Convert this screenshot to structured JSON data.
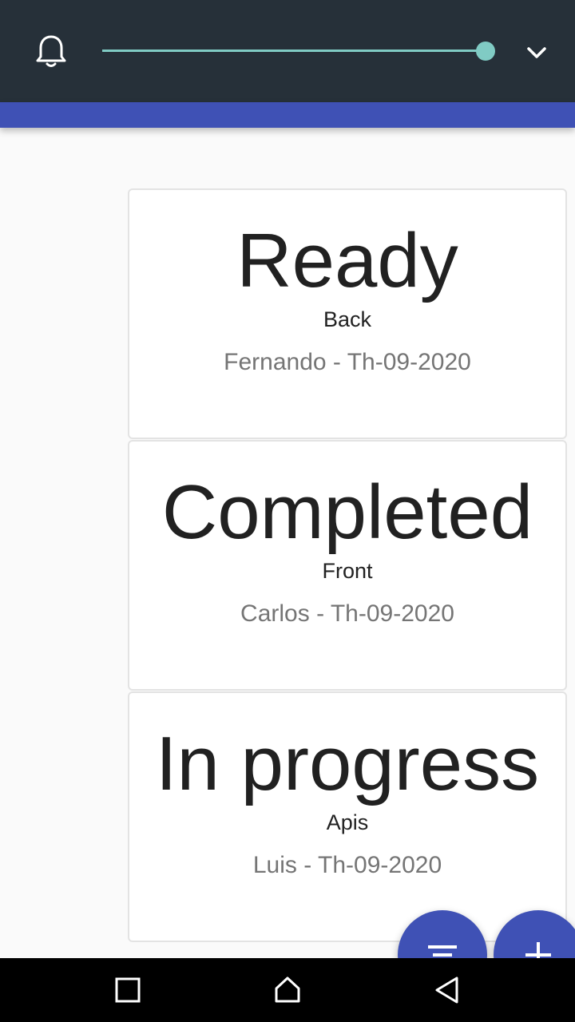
{
  "header": {
    "bell_icon": "bell-icon",
    "chevron_icon": "chevron-down-icon",
    "slider_value": 1.0,
    "accent_color": "#80cbc4",
    "bar_color": "#263039",
    "strip_color": "#3f51b5"
  },
  "cards": [
    {
      "status": "Ready",
      "area": "Back",
      "meta": "Fernando - Th-09-2020"
    },
    {
      "status": "Completed",
      "area": "Front",
      "meta": "Carlos - Th-09-2020"
    },
    {
      "status": "In progress",
      "area": "Apis",
      "meta": "Luis - Th-09-2020"
    }
  ],
  "fabs": {
    "filter_icon": "filter-icon",
    "add_icon": "plus-icon",
    "color": "#3f51b5"
  },
  "navbar": {
    "recents_icon": "recents-square-icon",
    "home_icon": "home-icon",
    "back_icon": "back-triangle-icon"
  }
}
